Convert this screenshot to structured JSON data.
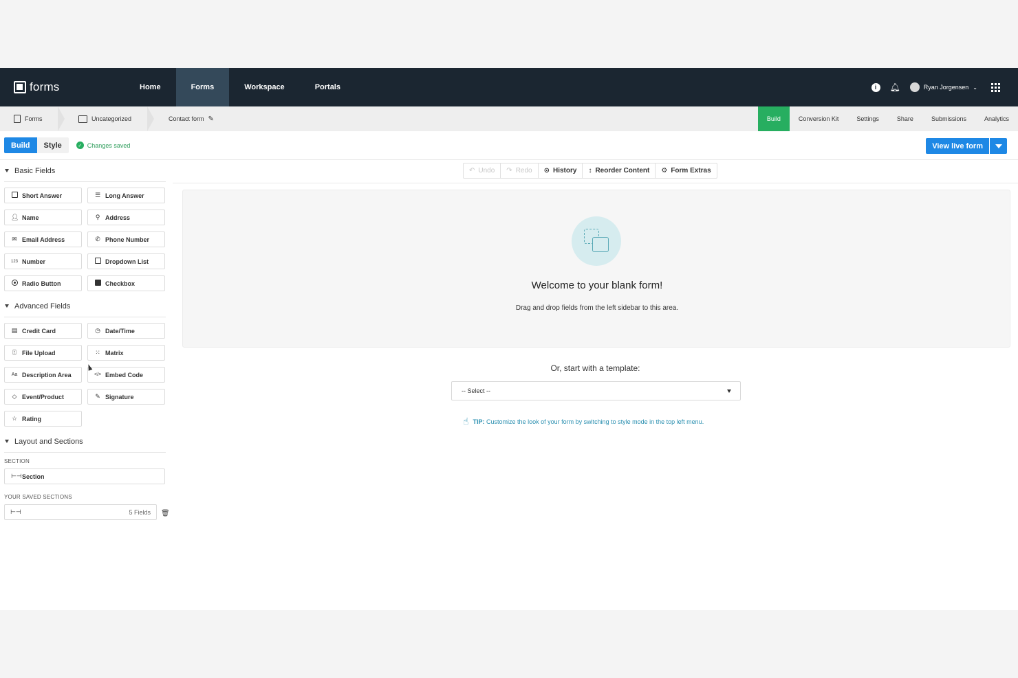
{
  "topnav": {
    "logo": "forms",
    "items": [
      {
        "label": "Home"
      },
      {
        "label": "Forms"
      },
      {
        "label": "Workspace"
      },
      {
        "label": "Portals"
      }
    ],
    "user_name": "Ryan Jorgensen"
  },
  "breadcrumb": {
    "forms": "Forms",
    "folder": "Uncategorized",
    "form_name": "Contact form"
  },
  "right_tabs": [
    {
      "label": "Build"
    },
    {
      "label": "Conversion Kit"
    },
    {
      "label": "Settings"
    },
    {
      "label": "Share"
    },
    {
      "label": "Submissions"
    },
    {
      "label": "Analytics"
    }
  ],
  "toolbar": {
    "build": "Build",
    "style": "Style",
    "status": "Changes saved",
    "view_live": "View live form"
  },
  "sidebar": {
    "basic_title": "Basic Fields",
    "basic": [
      {
        "label": "Short Answer",
        "icon": "short-answer-icon"
      },
      {
        "label": "Long Answer",
        "icon": "long-answer-icon"
      },
      {
        "label": "Name",
        "icon": "person-icon"
      },
      {
        "label": "Address",
        "icon": "map-pin-icon"
      },
      {
        "label": "Email Address",
        "icon": "envelope-icon"
      },
      {
        "label": "Phone Number",
        "icon": "phone-icon"
      },
      {
        "label": "Number",
        "icon": "number-icon",
        "glyph": "123"
      },
      {
        "label": "Dropdown List",
        "icon": "dropdown-icon"
      },
      {
        "label": "Radio Button",
        "icon": "radio-icon"
      },
      {
        "label": "Checkbox",
        "icon": "checkbox-icon"
      }
    ],
    "advanced_title": "Advanced Fields",
    "advanced": [
      {
        "label": "Credit Card",
        "icon": "credit-card-icon"
      },
      {
        "label": "Date/Time",
        "icon": "clock-icon"
      },
      {
        "label": "File Upload",
        "icon": "file-upload-icon"
      },
      {
        "label": "Matrix",
        "icon": "matrix-icon"
      },
      {
        "label": "Description Area",
        "icon": "text-icon",
        "glyph": "Aa"
      },
      {
        "label": "Embed Code",
        "icon": "code-icon",
        "glyph": "</>"
      },
      {
        "label": "Event/Product",
        "icon": "tag-icon"
      },
      {
        "label": "Signature",
        "icon": "pen-icon"
      },
      {
        "label": "Rating",
        "icon": "star-icon"
      }
    ],
    "layout_title": "Layout and Sections",
    "section_label": "SECTION",
    "section_item": "Section",
    "saved_label": "YOUR SAVED SECTIONS",
    "saved_count": "5 Fields"
  },
  "canvas": {
    "actions": [
      {
        "label": "Undo",
        "icon": "undo-icon",
        "glyph": "↶",
        "enabled": false
      },
      {
        "label": "Redo",
        "icon": "redo-icon",
        "glyph": "↷",
        "enabled": false
      },
      {
        "label": "History",
        "icon": "history-icon",
        "glyph": "⊙",
        "enabled": true
      },
      {
        "label": "Reorder Content",
        "icon": "reorder-icon",
        "glyph": "↕",
        "enabled": true
      },
      {
        "label": "Form Extras",
        "icon": "gear-icon",
        "glyph": "⚙",
        "enabled": true
      }
    ],
    "welcome_title": "Welcome to your blank form!",
    "welcome_sub": "Drag and drop fields from the left sidebar to this area.",
    "template_prompt": "Or, start with a template:",
    "template_placeholder": "-- Select --",
    "tip_label": "TIP:",
    "tip_text": "Customize the look of your form by switching to style mode in the top left menu."
  },
  "colors": {
    "nav_bg": "#1b2631",
    "primary": "#1e88e5",
    "success": "#27ae60",
    "tip": "#2a8fb0"
  }
}
